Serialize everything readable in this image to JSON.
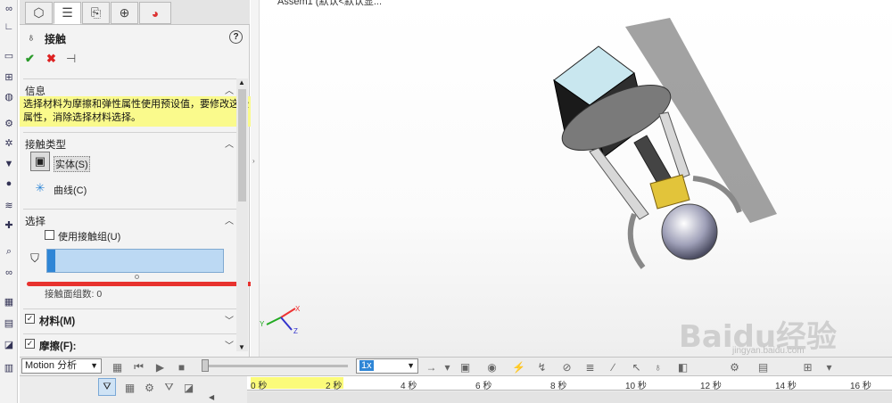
{
  "feature": {
    "title": "接触",
    "help": "?"
  },
  "actions": {
    "ok": "✔",
    "cancel": "✖",
    "pin": "⊣"
  },
  "info": {
    "header": "信息",
    "text": "选择材料为摩擦和弹性属性使用预设值，要修改这些属性，消除选择材料选择。"
  },
  "contact_type": {
    "header": "接触类型",
    "solid": "实体(S)",
    "curve": "曲线(C)"
  },
  "selection": {
    "header": "选择",
    "use_group_label": "使用接触组(U)",
    "count_label": "接触面组数: 0"
  },
  "material": {
    "label": "材料(M)"
  },
  "friction": {
    "label": "摩擦(F):"
  },
  "viewport": {
    "doc_title": "Assem1 (默认<默认显..."
  },
  "triad": {
    "x": "X",
    "y": "Y",
    "z": "Z"
  },
  "motion": {
    "study_type": "Motion 分析",
    "speed": "1x"
  },
  "timeline": {
    "ticks": [
      "0 秒",
      "2 秒",
      "4 秒",
      "6 秒",
      "8 秒",
      "10 秒",
      "12 秒",
      "14 秒",
      "16 秒"
    ]
  },
  "watermark": {
    "text": "Baidu经验",
    "sub": "jingyan.baidu.com"
  },
  "colors": {
    "highlight": "#fafa8c",
    "accent": "#2f86d6",
    "selection_box": "#bcd9f3",
    "red_stroke": "#e8322e"
  }
}
